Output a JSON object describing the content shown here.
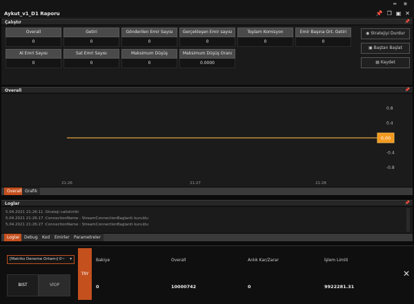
{
  "window": {
    "title": "Aykut_v1_D1 Raporu"
  },
  "sections": {
    "calistir": "Çalıştır",
    "overall": "Overall",
    "loglar": "Loglar"
  },
  "stats": [
    {
      "label": "Overall",
      "value": "0"
    },
    {
      "label": "Getiri",
      "value": "0"
    },
    {
      "label": "Gönderilen Emir Sayısı",
      "value": "0"
    },
    {
      "label": "Gerçekleşen Emir sayısı",
      "value": "0"
    },
    {
      "label": "Toplam Komisyon",
      "value": "0"
    },
    {
      "label": "Emir Başına Ort. Getiri",
      "value": "0"
    },
    {
      "label": "Al Emri Sayısı",
      "value": "0"
    },
    {
      "label": "Sat Emri Sayısı",
      "value": "0"
    },
    {
      "label": "Maksimum Düşüş",
      "value": "0"
    },
    {
      "label": "Maksimum Düşüş Oranı",
      "value": "0.0000"
    }
  ],
  "actions": {
    "stop": "Stratejiyi Durdur",
    "restart": "Baştan Başlat",
    "save": "Kaydet"
  },
  "chart_data": {
    "type": "line",
    "x": [
      "21:26",
      "21:27",
      "21:28"
    ],
    "y_ticks": [
      "0.8",
      "0.4",
      "-0.4",
      "-0.8"
    ],
    "ylim": [
      -1,
      1
    ],
    "series": [
      {
        "values": [
          0,
          0,
          0
        ]
      }
    ],
    "current_value_label": "0,00",
    "line_color": "#e8a33c"
  },
  "chart_tabs": [
    "Overall",
    "Grafik"
  ],
  "logs": [
    "5.04.2021 21:26:11 :Strateji calistirildi",
    "5.04.2021 21:26:17 :ConnectionName : StreamConnectionBaglanti kuruldu",
    "5.04.2021 21:26:27 :ConnectionName : StreamConnectionBaglanti kuruldu"
  ],
  "log_tabs": [
    "Loglar",
    "Debug",
    "Kod",
    "Emirler",
    "Parametreler"
  ],
  "bottom": {
    "account_select": "[Matriks Deneme Ortamı] 0~",
    "market_bist": "BIST",
    "market_viop": "VİOP",
    "currency": "TRY",
    "columns": [
      {
        "label": "Bakiye",
        "value": "0"
      },
      {
        "label": "Overall",
        "value": "10000742"
      },
      {
        "label": "Anlık Kar/Zarar",
        "value": "0"
      },
      {
        "label": "İşlem Limiti",
        "value": "9922281.31"
      }
    ],
    "close": "✕"
  },
  "colors": {
    "accent": "#c4501e",
    "background": "#0b0b0b"
  }
}
